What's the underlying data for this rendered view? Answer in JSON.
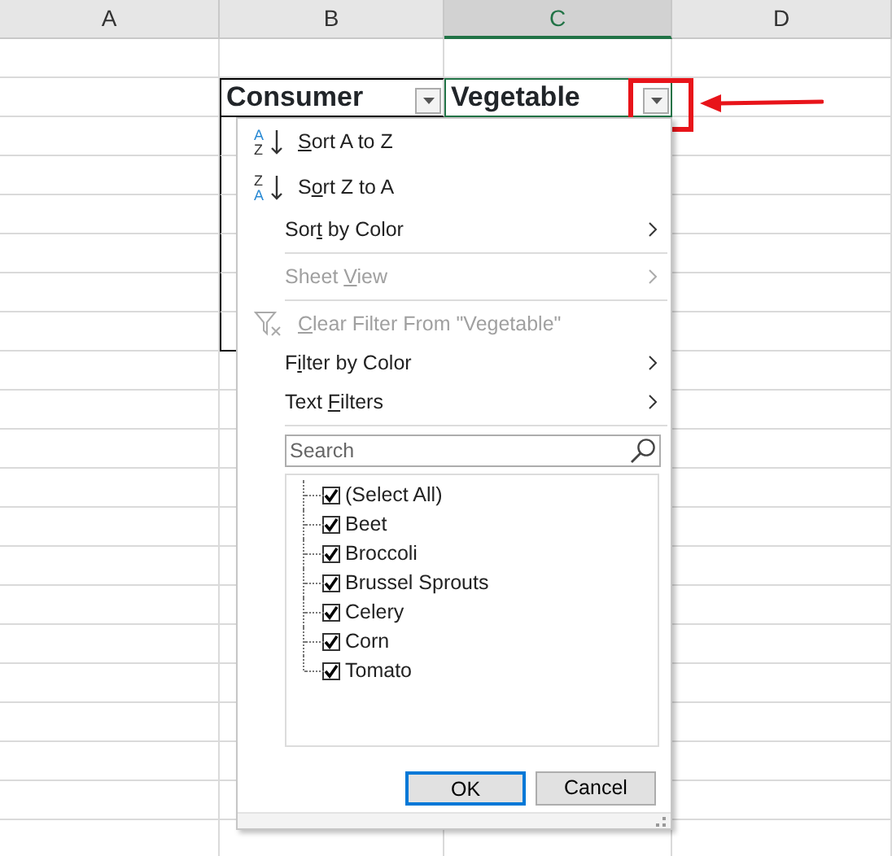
{
  "columns": [
    {
      "label": "A",
      "selected": false
    },
    {
      "label": "B",
      "selected": false
    },
    {
      "label": "C",
      "selected": true
    },
    {
      "label": "D",
      "selected": false
    }
  ],
  "table": {
    "headers": [
      "Consumer",
      "Vegetable"
    ]
  },
  "filter_menu": {
    "items": [
      {
        "kind": "sort_asc",
        "icon_letters": [
          "A",
          "Z"
        ],
        "key": "S",
        "post": "ort A to Z",
        "disabled": false
      },
      {
        "kind": "sort_desc",
        "icon_letters": [
          "Z",
          "A"
        ],
        "pre": "S",
        "key": "o",
        "post": "rt Z to A",
        "disabled": false
      },
      {
        "kind": "submenu",
        "pre": "Sor",
        "key": "t",
        "post": " by Color",
        "disabled": false
      },
      {
        "kind": "separator"
      },
      {
        "kind": "submenu",
        "pre": "Sheet ",
        "key": "V",
        "post": "iew",
        "disabled": true
      },
      {
        "kind": "separator"
      },
      {
        "kind": "clear",
        "key": "C",
        "post": "lear Filter From \"Vegetable\"",
        "disabled": true
      },
      {
        "kind": "submenu",
        "pre": "F",
        "key": "i",
        "post": "lter by Color",
        "disabled": false
      },
      {
        "kind": "submenu",
        "pre": "Text ",
        "key": "F",
        "post": "ilters",
        "disabled": false
      },
      {
        "kind": "separator"
      }
    ],
    "search": {
      "placeholder": "Search"
    },
    "values": [
      {
        "label": "(Select All)",
        "checked": true
      },
      {
        "label": "Beet",
        "checked": true
      },
      {
        "label": "Broccoli",
        "checked": true
      },
      {
        "label": "Brussel Sprouts",
        "checked": true
      },
      {
        "label": "Celery",
        "checked": true
      },
      {
        "label": "Corn",
        "checked": true
      },
      {
        "label": "Tomato",
        "checked": true
      }
    ],
    "buttons": [
      {
        "label": "OK",
        "default": true
      },
      {
        "label": "Cancel",
        "default": false
      }
    ]
  }
}
